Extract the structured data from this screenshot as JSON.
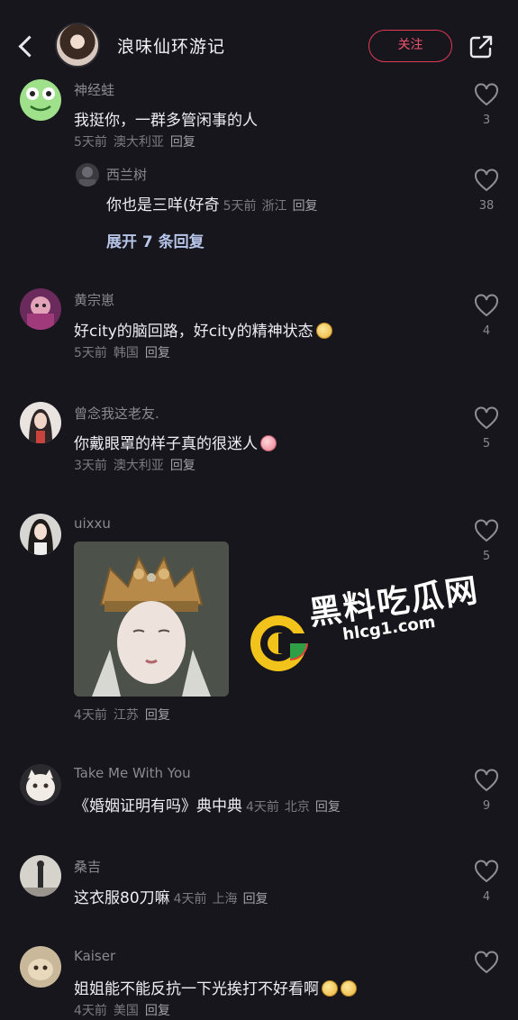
{
  "header": {
    "title": "浪味仙环游记",
    "follow_label": "关注",
    "icons": {
      "back": "back-arrow-icon",
      "share": "share-external-icon"
    }
  },
  "comments": [
    {
      "name": "神经蛙",
      "text": "我挺你，一群多管闲事的人",
      "time": "5天前",
      "location": "澳大利亚",
      "reply": "回复",
      "likes": "3"
    },
    {
      "name": "西兰树",
      "text": "你也是三咩(好奇",
      "time": "5天前",
      "location": "浙江",
      "reply": "回复",
      "likes": "38"
    },
    {
      "name": "黄宗崽",
      "text": "好city的脑回路，好city的精神状态",
      "time": "5天前",
      "location": "韩国",
      "reply": "回复",
      "likes": "4"
    },
    {
      "name": "曾念我这老友.",
      "text": "你戴眼罩的样子真的很迷人",
      "time": "3天前",
      "location": "澳大利亚",
      "reply": "回复",
      "likes": "5"
    },
    {
      "name": "uixxu",
      "text": "",
      "time": "4天前",
      "location": "江苏",
      "reply": "回复",
      "likes": "5"
    },
    {
      "name": "Take Me With You",
      "text": "《婚姻证明有吗》典中典",
      "time": "4天前",
      "location": "北京",
      "reply": "回复",
      "likes": "9"
    },
    {
      "name": "桑吉",
      "text": "这衣服80刀嘛",
      "time": "4天前",
      "location": "上海",
      "reply": "回复",
      "likes": "4"
    },
    {
      "name": "Kaiser",
      "text": "姐姐能不能反抗一下光挨打不好看啊",
      "time": "4天前",
      "location": "美国",
      "reply": "回复",
      "likes": ""
    }
  ],
  "expand_replies": "展开 7 条回复",
  "watermark": {
    "text": "黑料吃瓜网",
    "url": "hlcg1.com"
  },
  "colors": {
    "background": "#17161c",
    "accent": "#e23a55",
    "link": "#b7c5e9"
  }
}
